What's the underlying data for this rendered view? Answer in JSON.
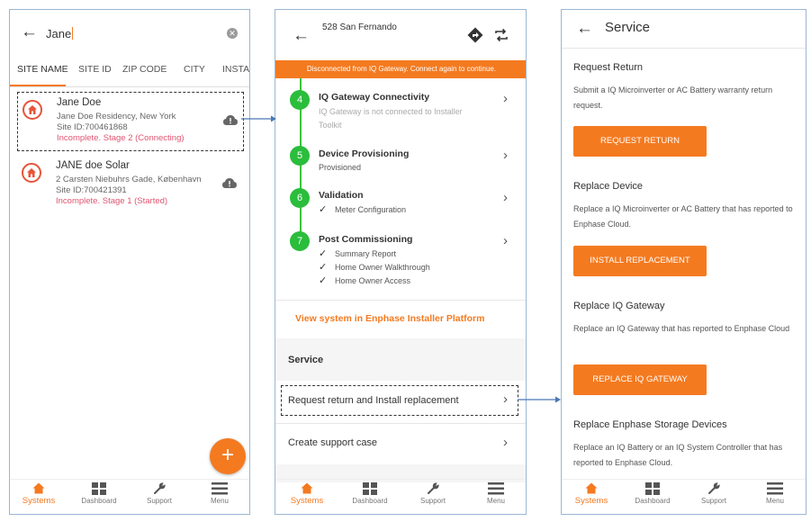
{
  "search_screen": {
    "query": "Jane",
    "tabs": [
      "SITE NAME",
      "SITE ID",
      "ZIP CODE",
      "CITY",
      "INSTAL"
    ],
    "sites": [
      {
        "name": "Jane Doe",
        "address": "Jane Doe Residency, New York",
        "site_id": "Site ID:700461868",
        "status": "Incomplete. Stage 2 (Connecting)"
      },
      {
        "name": "JANE doe Solar",
        "address": "2 Carsten Niebuhrs Gade, København",
        "site_id": "Site ID:700421391",
        "status": "Incomplete. Stage 1 (Started)"
      }
    ],
    "fab_label": "+"
  },
  "system_screen": {
    "title": "528 San Fernando",
    "banner": "Disconnected from IQ Gateway. Connect again to continue.",
    "steps": [
      {
        "num": "4",
        "title": "IQ Gateway Connectivity",
        "subtitle": "IQ Gateway is not connected to Installer Toolkit"
      },
      {
        "num": "5",
        "title": "Device Provisioning",
        "subtitle": "Provisioned"
      },
      {
        "num": "6",
        "title": "Validation",
        "checks": [
          "Meter Configuration"
        ]
      },
      {
        "num": "7",
        "title": "Post Commissioning",
        "checks": [
          "Summary Report",
          "Home Owner Walkthrough",
          "Home Owner Access"
        ]
      }
    ],
    "platform_link": "View system in Enphase Installer Platform",
    "service_label": "Service",
    "service_rows": [
      "Request return and Install replacement",
      "Create support case"
    ]
  },
  "service_screen": {
    "title": "Service",
    "sections": [
      {
        "heading": "Request Return",
        "description": "Submit a IQ Microinverter or AC Battery warranty return request.",
        "button": "REQUEST RETURN"
      },
      {
        "heading": "Replace Device",
        "description": "Replace a IQ Microinverter or AC Battery that has reported to Enphase Cloud.",
        "button": "INSTALL REPLACEMENT"
      },
      {
        "heading": "Replace IQ Gateway",
        "description": "Replace an IQ Gateway that has reported to Enphase Cloud",
        "button": "REPLACE IQ GATEWAY"
      },
      {
        "heading": "Replace Enphase Storage Devices",
        "description": "Replace an IQ Battery or an IQ System Controller that has reported to Enphase Cloud."
      }
    ]
  },
  "bottom_nav": [
    "Systems",
    "Dashboard",
    "Support",
    "Menu"
  ],
  "colors": {
    "accent": "#f47a20",
    "success": "#2bbd3c",
    "status_warning": "#e05470",
    "frame_border": "#9bb7d4"
  }
}
